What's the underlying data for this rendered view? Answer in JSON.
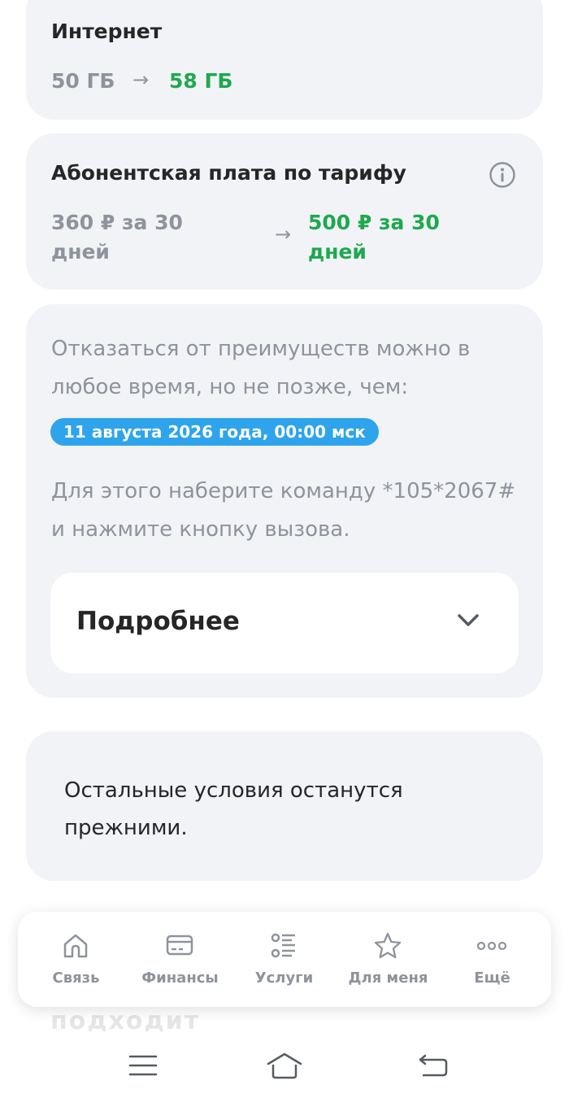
{
  "internet": {
    "title": "Интернет",
    "old_value": "50 ГБ",
    "new_value": "58 ГБ"
  },
  "fee": {
    "title": "Абонентская плата по тарифу",
    "old_line1": "360 ₽ за 30",
    "old_line2": "дней",
    "new_line1": "500 ₽ за 30",
    "new_line2": "дней"
  },
  "arrow_symbol": "→",
  "cancel": {
    "line1": "Отказаться от преимуществ можно в",
    "line2": "любое время, но не позже, чем:",
    "deadline": "11 августа 2026 года, 00:00 мск",
    "instruction_line1": "Для этого наберите команду *105*2067#",
    "instruction_line2": "и нажмите кнопку вызова.",
    "more_label": "Подробнее"
  },
  "rest": {
    "line1": "Остальные условия останутся",
    "line2": "прежними."
  },
  "faded_behind": "подходит",
  "tabbar": {
    "tabs": [
      {
        "label": "Связь",
        "icon": "home-icon"
      },
      {
        "label": "Финансы",
        "icon": "card-icon"
      },
      {
        "label": "Услуги",
        "icon": "services-list-icon"
      },
      {
        "label": "Для меня",
        "icon": "star-icon"
      },
      {
        "label": "Ещё",
        "icon": "more-dots-icon"
      }
    ]
  },
  "colors": {
    "accent_green": "#1fa84f",
    "badge_blue": "#2ea4ec",
    "muted": "#8e939c",
    "card_bg": "#f2f3f7"
  }
}
